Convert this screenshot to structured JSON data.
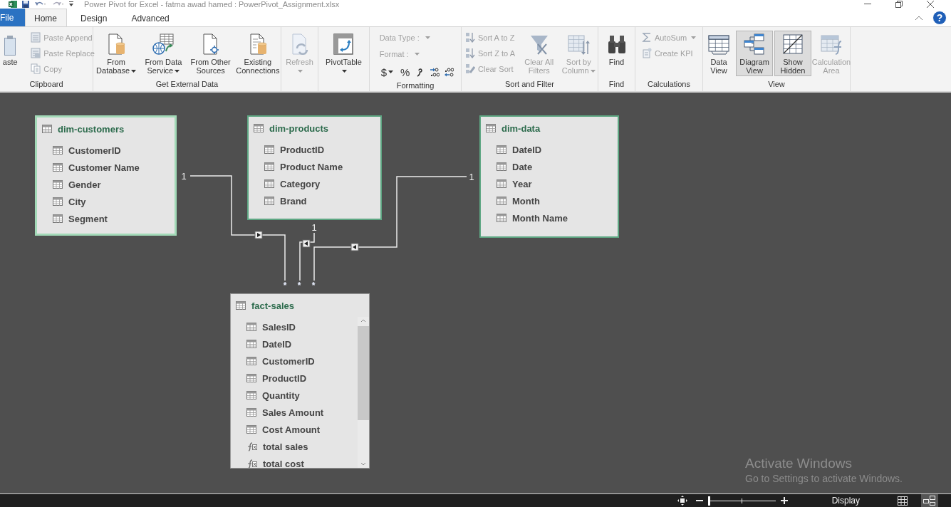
{
  "title_bar": {
    "title": "Power Pivot for Excel - fatma awad hamed : PowerPivot_Assignment.xlsx"
  },
  "tabs": [
    {
      "label": "File",
      "kind": "file",
      "selected": false
    },
    {
      "label": "Home",
      "kind": "tab",
      "selected": true
    },
    {
      "label": "Design",
      "kind": "tab",
      "selected": false
    },
    {
      "label": "Advanced",
      "kind": "tab",
      "selected": false
    }
  ],
  "help": {
    "label": "?"
  },
  "ribbon": {
    "groups": [
      {
        "label": "Clipboard",
        "items": [
          {
            "kind": "large",
            "label": "aste",
            "disabled": false
          },
          {
            "kind": "small",
            "label": "Paste Append",
            "disabled": true
          },
          {
            "kind": "small",
            "label": "Paste Replace",
            "disabled": true
          },
          {
            "kind": "small",
            "label": "Copy",
            "disabled": true
          }
        ]
      },
      {
        "label": "Get External Data",
        "items": [
          {
            "kind": "large",
            "label": "From Database",
            "dropdown": true
          },
          {
            "kind": "large",
            "label": "From Data Service",
            "dropdown": true
          },
          {
            "kind": "large",
            "label": "From Other Sources"
          },
          {
            "kind": "large",
            "label": "Existing Connections"
          }
        ]
      },
      {
        "items": [
          {
            "kind": "large",
            "label": "Refresh",
            "disabled": true,
            "dropdown": true
          }
        ]
      },
      {
        "items": [
          {
            "kind": "large",
            "label": "PivotTable",
            "dropdown": true
          }
        ]
      },
      {
        "label": "Formatting",
        "items": [
          {
            "kind": "combo",
            "label": "Data Type :",
            "disabled": true
          },
          {
            "kind": "combo",
            "label": "Format :",
            "disabled": true
          },
          {
            "kind": "toolbar",
            "buttons": [
              {
                "kind": "text",
                "label": "$",
                "dropdown": true
              },
              {
                "kind": "text",
                "label": "%"
              },
              {
                "kind": "icon"
              },
              {
                "kind": "icon"
              },
              {
                "kind": "icon"
              }
            ]
          }
        ]
      },
      {
        "label": "Sort and Filter",
        "items": [
          {
            "kind": "small",
            "label": "Sort A to Z",
            "disabled": true
          },
          {
            "kind": "small",
            "label": "Sort Z to A",
            "disabled": true
          },
          {
            "kind": "small",
            "label": "Clear Sort",
            "disabled": true
          },
          {
            "kind": "large",
            "label": "Clear All Filters",
            "disabled": true
          },
          {
            "kind": "large",
            "label": "Sort by Column",
            "disabled": true,
            "dropdown": true
          }
        ]
      },
      {
        "label": "Find",
        "items": [
          {
            "kind": "large",
            "label": "Find"
          }
        ]
      },
      {
        "label": "Calculations",
        "items": [
          {
            "kind": "small",
            "label": "AutoSum",
            "disabled": true,
            "dropdown": true
          },
          {
            "kind": "small",
            "label": "Create KPI",
            "disabled": true
          }
        ]
      },
      {
        "label": "View",
        "items": [
          {
            "kind": "large",
            "label": "Data View",
            "pressed": false
          },
          {
            "kind": "large",
            "label": "Diagram View",
            "pressed": true
          },
          {
            "kind": "large",
            "label": "Show Hidden",
            "pressed": true
          },
          {
            "kind": "large",
            "label": "Calculation Area",
            "disabled": true
          }
        ]
      }
    ]
  },
  "diagram": {
    "tables": [
      {
        "name": "dim-customers",
        "kind": "dimension",
        "selected": true,
        "columns": [
          {
            "name": "CustomerID",
            "kind": "column"
          },
          {
            "name": "Customer Name",
            "kind": "column"
          },
          {
            "name": "Gender",
            "kind": "column"
          },
          {
            "name": "City",
            "kind": "column"
          },
          {
            "name": "Segment",
            "kind": "column"
          }
        ]
      },
      {
        "name": "dim-products",
        "kind": "dimension",
        "selected": false,
        "columns": [
          {
            "name": "ProductID",
            "kind": "column"
          },
          {
            "name": "Product Name",
            "kind": "column"
          },
          {
            "name": "Category",
            "kind": "column"
          },
          {
            "name": "Brand",
            "kind": "column"
          }
        ]
      },
      {
        "name": "dim-data",
        "kind": "dimension",
        "selected": false,
        "columns": [
          {
            "name": "DateID",
            "kind": "column"
          },
          {
            "name": "Date",
            "kind": "column"
          },
          {
            "name": "Year",
            "kind": "column"
          },
          {
            "name": "Month",
            "kind": "column"
          },
          {
            "name": "Month Name",
            "kind": "column"
          }
        ]
      },
      {
        "name": "fact-sales",
        "kind": "fact",
        "selected": false,
        "columns": [
          {
            "name": "SalesID",
            "kind": "column"
          },
          {
            "name": "DateID",
            "kind": "column"
          },
          {
            "name": "CustomerID",
            "kind": "column"
          },
          {
            "name": "ProductID",
            "kind": "column"
          },
          {
            "name": "Quantity",
            "kind": "column"
          },
          {
            "name": "Sales Amount",
            "kind": "column"
          },
          {
            "name": "Cost Amount",
            "kind": "column"
          },
          {
            "name": "total sales",
            "kind": "measure"
          },
          {
            "name": "total cost",
            "kind": "measure"
          }
        ]
      }
    ],
    "relationships": [
      {
        "one_label": "1",
        "many_label": "*"
      },
      {
        "one_label": "1",
        "many_label": "*"
      },
      {
        "one_label": "1",
        "many_label": "*"
      }
    ]
  },
  "activation_notice": {
    "title": "Activate Windows",
    "message": "Go to Settings to activate Windows."
  },
  "status_bar": {
    "zoom": {
      "level": 0
    },
    "display_label": "Display",
    "views": [
      {
        "kind": "grid",
        "selected": false
      },
      {
        "kind": "diagram",
        "selected": true
      }
    ]
  }
}
